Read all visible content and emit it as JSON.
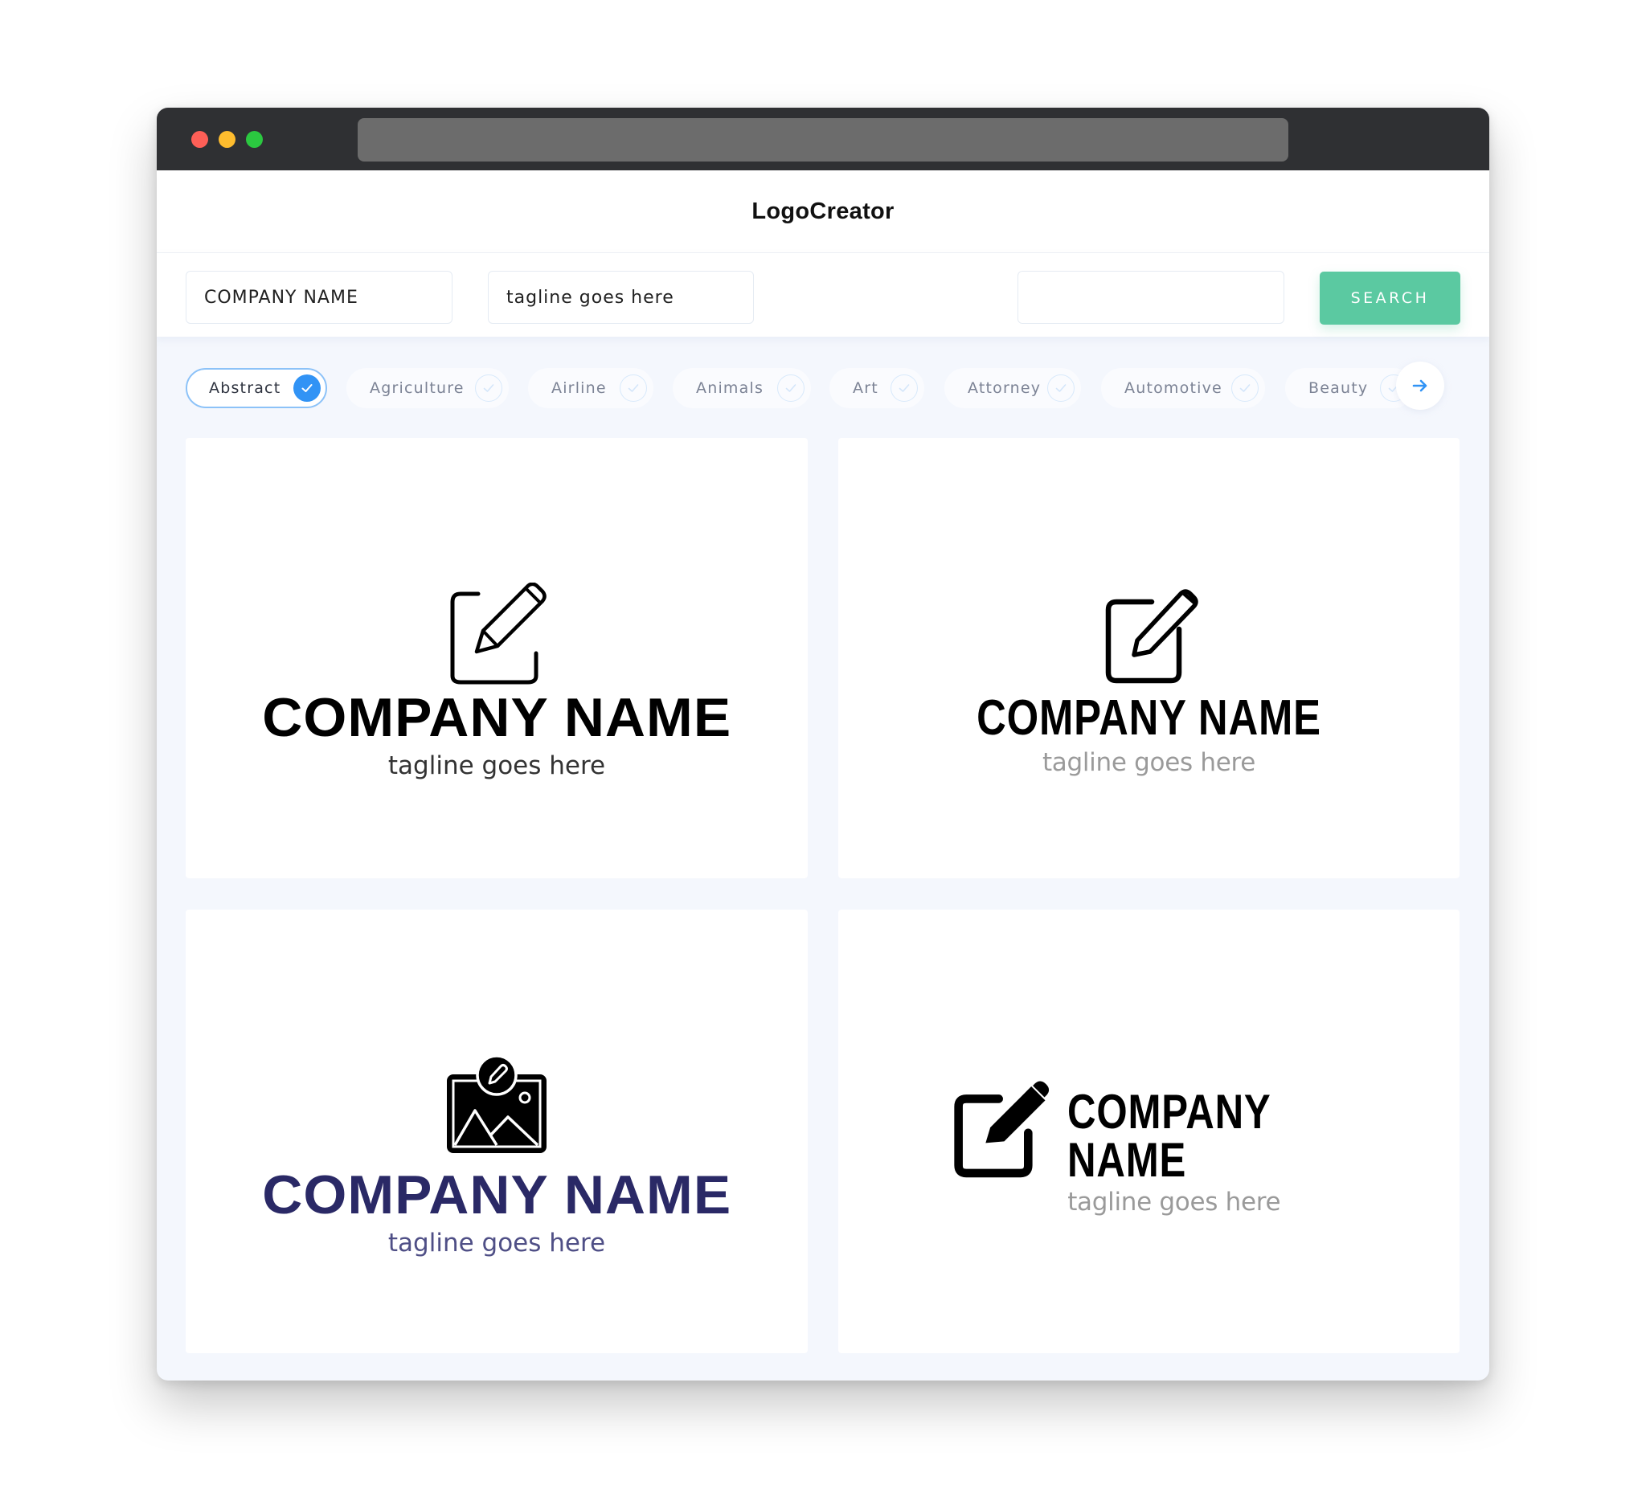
{
  "window": {
    "traffic_lights": [
      "close",
      "minimize",
      "maximize"
    ]
  },
  "header": {
    "title": "LogoCreator"
  },
  "search": {
    "company_name_value": "COMPANY NAME",
    "tagline_value": "tagline goes here",
    "extra_value": "",
    "button_label": "SEARCH"
  },
  "categories": {
    "items": [
      {
        "label": "Abstract",
        "selected": true
      },
      {
        "label": "Agriculture",
        "selected": false
      },
      {
        "label": "Airline",
        "selected": false
      },
      {
        "label": "Animals",
        "selected": false
      },
      {
        "label": "Art",
        "selected": false
      },
      {
        "label": "Attorney",
        "selected": false
      },
      {
        "label": "Automotive",
        "selected": false
      },
      {
        "label": "Beauty",
        "selected": false
      }
    ],
    "next_icon": "arrow-right-icon"
  },
  "logos": [
    {
      "icon": "edit-note-outline-icon",
      "company": "COMPANY NAME",
      "tagline": "tagline goes here",
      "color": "#000000"
    },
    {
      "icon": "edit-note-outline-icon",
      "company": "COMPANY NAME",
      "tagline": "tagline goes here",
      "color": "#000000"
    },
    {
      "icon": "image-edit-icon",
      "company": "COMPANY NAME",
      "tagline": "tagline goes here",
      "color": "#2a2966"
    },
    {
      "icon": "edit-note-filled-icon",
      "company": "COMPANY NAME",
      "tagline": "tagline goes here",
      "color": "#000000"
    }
  ],
  "colors": {
    "accent": "#5bc9a1",
    "selected_chip": "#3193f5",
    "navy": "#2a2966"
  }
}
